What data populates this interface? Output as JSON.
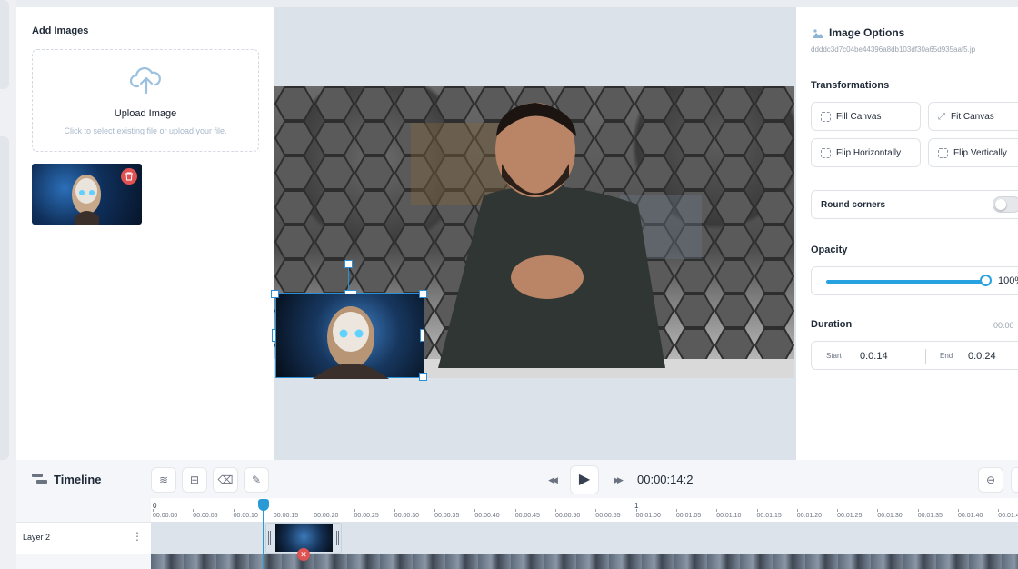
{
  "left_panel": {
    "title": "Add Images",
    "upload": {
      "title": "Upload Image",
      "hint": "Click to select existing file or upload your file."
    }
  },
  "right_panel": {
    "title": "Image Options",
    "filename": "ddddc3d7c04be44396a8db103df30a65d935aaf5.jp",
    "transformations_label": "Transformations",
    "buttons": {
      "fill_canvas": "Fill Canvas",
      "fit_canvas": "Fit Canvas",
      "flip_horizontally": "Flip Horizontally",
      "flip_vertically": "Flip Vertically"
    },
    "round_corners_label": "Round corners",
    "round_corners_on": false,
    "opacity_label": "Opacity",
    "opacity_value": "100%",
    "opacity_fraction": 1.0,
    "duration_label": "Duration",
    "duration_value": "00:00",
    "start_label": "Start",
    "start_value": "0:0:14",
    "end_label": "End",
    "end_value": "0:0:24"
  },
  "timeline": {
    "title": "Timeline",
    "time": "00:00:14:2",
    "major_ticks": [
      "0",
      "1"
    ],
    "ticks": [
      "00:00:00",
      "00:00:05",
      "00:00:10",
      "00:00:15",
      "00:00:20",
      "00:00:25",
      "00:00:30",
      "00:00:35",
      "00:00:40",
      "00:00:45",
      "00:00:50",
      "00:00:55",
      "00:01:00",
      "00:01:05",
      "00:01:10",
      "00:01:15",
      "00:01:20",
      "00:01:25",
      "00:01:30",
      "00:01:35",
      "00:01:40",
      "00:01:4"
    ],
    "layer_name": "Layer 2",
    "layer_menu": "⋮"
  },
  "icons": {
    "upload": "upload-cloud-icon",
    "delete": "trash-icon",
    "image": "image-icon",
    "rewind": "◀◀",
    "play": "▶",
    "forward": "▶▶",
    "remove": "✕"
  },
  "colors": {
    "accent": "#27a1e0",
    "danger": "#e05252",
    "panel": "#ffffff",
    "stage": "#dbe2ea"
  }
}
